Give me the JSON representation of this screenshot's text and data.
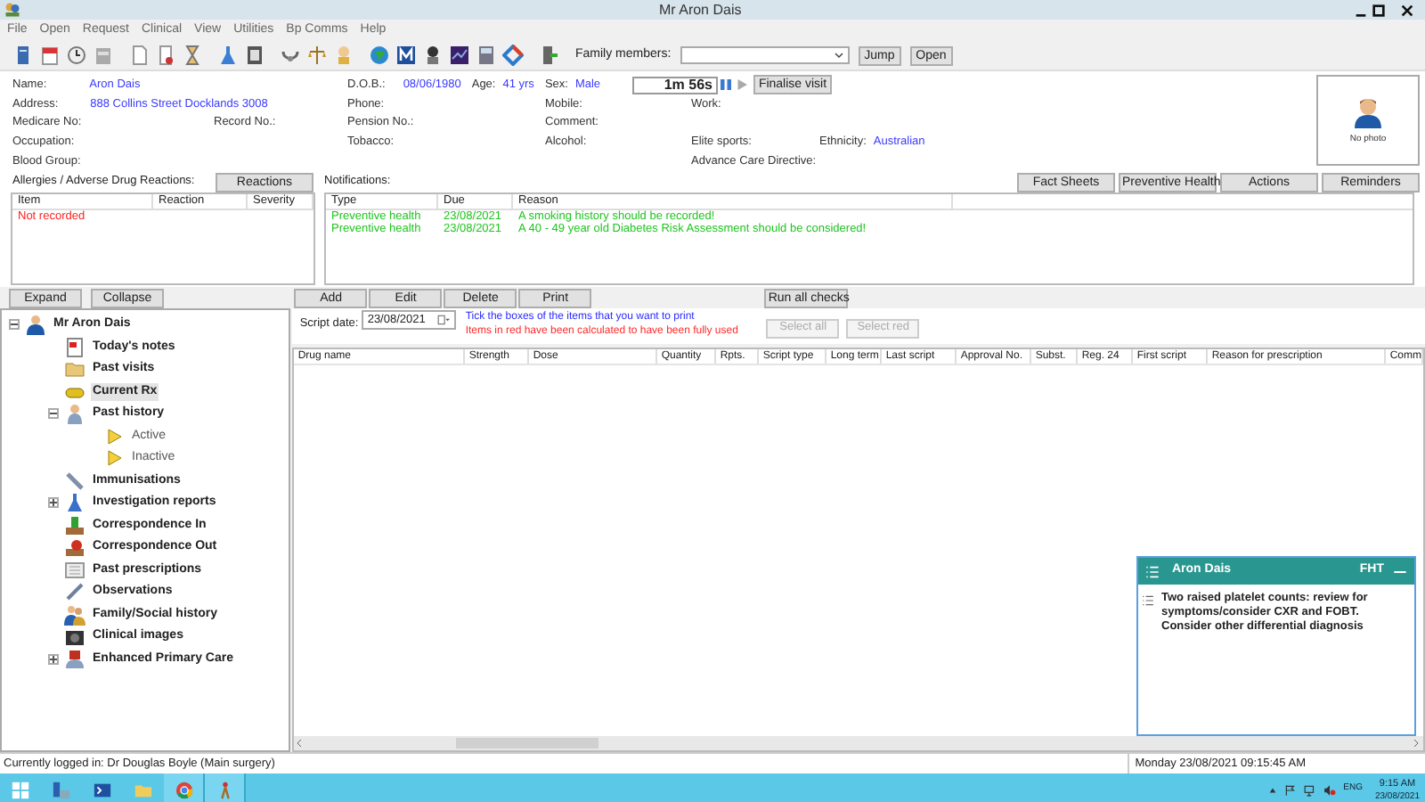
{
  "window": {
    "title": "Mr Aron Dais"
  },
  "menu": [
    "File",
    "Open",
    "Request",
    "Clinical",
    "View",
    "Utilities",
    "Bp Comms",
    "Help"
  ],
  "toolbar": {
    "family_label": "Family members:",
    "buttons": [
      "Jump",
      "Open"
    ]
  },
  "patient": {
    "name": {
      "label": "Name:",
      "value": "Aron Dais"
    },
    "address": {
      "label": "Address:",
      "value": "888 Collins Street  Docklands  3008"
    },
    "medicare": {
      "label": "Medicare No:"
    },
    "record": {
      "label": "Record No.:"
    },
    "occupation": {
      "label": "Occupation:"
    },
    "blood_group": {
      "label": "Blood Group:"
    },
    "dob": {
      "label": "D.O.B.:",
      "value": "08/06/1980"
    },
    "age": {
      "label": "Age:",
      "value": "41 yrs"
    },
    "sex": {
      "label": "Sex:",
      "value": "Male"
    },
    "phone": {
      "label": "Phone:"
    },
    "pension": {
      "label": "Pension No.:"
    },
    "tobacco": {
      "label": "Tobacco:"
    },
    "mobile": {
      "label": "Mobile:"
    },
    "comment": {
      "label": "Comment:"
    },
    "alcohol": {
      "label": "Alcohol:"
    },
    "work": {
      "label": "Work:"
    },
    "elite_sports": {
      "label": "Elite sports:"
    },
    "ethnicity": {
      "label": "Ethnicity:",
      "value": "Australian"
    },
    "advance_care": {
      "label": "Advance Care Directive:"
    },
    "timer": "1m  56s",
    "finalise": "Finalise visit",
    "photo_caption": "No photo"
  },
  "allergies": {
    "label": "Allergies / Adverse Drug Reactions:",
    "button": "Reactions",
    "columns": [
      "Item",
      "Reaction",
      "Severity"
    ],
    "rows": [
      [
        "Not recorded"
      ]
    ]
  },
  "notifications": {
    "label": "Notifications:",
    "buttons": [
      "Fact Sheets",
      "Preventive Health",
      "Actions",
      "Reminders"
    ],
    "columns": [
      "Type",
      "Due",
      "Reason"
    ],
    "rows": [
      [
        "Preventive health",
        "23/08/2021",
        "A smoking history should be recorded!"
      ],
      [
        "Preventive health",
        "23/08/2021",
        "A 40 - 49 year old Diabetes Risk Assessment should be considered!"
      ]
    ]
  },
  "tree_buttons": [
    "Expand",
    "Collapse"
  ],
  "tree": {
    "label": "Mr Aron Dais",
    "kind": "person",
    "expanded": true,
    "children": [
      {
        "label": "Today's notes",
        "kind": "notes",
        "selected": false
      },
      {
        "label": "Past visits",
        "kind": "folder",
        "selected": false
      },
      {
        "label": "Current Rx",
        "kind": "pill",
        "selected": true
      },
      {
        "label": "Past history",
        "kind": "doctor",
        "selected": false,
        "expanded": true,
        "children": [
          {
            "label": "Active",
            "kind": "arrow",
            "selected": false
          },
          {
            "label": "Inactive",
            "kind": "arrow",
            "selected": false
          }
        ]
      },
      {
        "label": "Immunisations",
        "kind": "syringe",
        "selected": false
      },
      {
        "label": "Investigation reports",
        "kind": "flask",
        "selected": false,
        "expanded": false
      },
      {
        "label": "Correspondence In",
        "kind": "inbox",
        "selected": false
      },
      {
        "label": "Correspondence Out",
        "kind": "outbox",
        "selected": false
      },
      {
        "label": "Past prescriptions",
        "kind": "list",
        "selected": false
      },
      {
        "label": "Observations",
        "kind": "pen",
        "selected": false
      },
      {
        "label": "Family/Social history",
        "kind": "family",
        "selected": false
      },
      {
        "label": "Clinical images",
        "kind": "camera",
        "selected": false
      },
      {
        "label": "Enhanced Primary Care",
        "kind": "device",
        "selected": false,
        "expanded": false
      }
    ]
  },
  "rx": {
    "buttons": [
      "Add",
      "Edit",
      "Delete",
      "Print"
    ],
    "run_checks": "Run all checks",
    "script_date_label": "Script date:",
    "script_date": "23/08/2021",
    "hints": [
      {
        "kind": "info",
        "text": "Tick the boxes of the items that you want to print"
      },
      {
        "kind": "warning",
        "text": "Items in red have been calculated to have been fully used"
      }
    ],
    "select_buttons": [
      {
        "label": "Select all",
        "disabled": true
      },
      {
        "label": "Select red",
        "disabled": true
      }
    ],
    "columns": [
      "Drug name",
      "Strength",
      "Dose",
      "Quantity",
      "Rpts.",
      "Script type",
      "Long term",
      "Last script",
      "Approval No.",
      "Subst.",
      "Reg. 24",
      "First script",
      "Reason for prescription",
      "Comm"
    ]
  },
  "popup": {
    "title": "Aron Dais",
    "badge": "FHT",
    "message": "Two raised platelet counts: review for symptoms/consider CXR and FOBT. Consider other differential diagnosis"
  },
  "status_bar": {
    "user": "Currently logged in:  Dr Douglas Boyle (Main surgery)",
    "datetime": "Monday 23/08/2021 09:15:45 AM"
  },
  "taskbar": {
    "language": "ENG",
    "time": "9:15 AM",
    "date": "23/08/2021"
  }
}
